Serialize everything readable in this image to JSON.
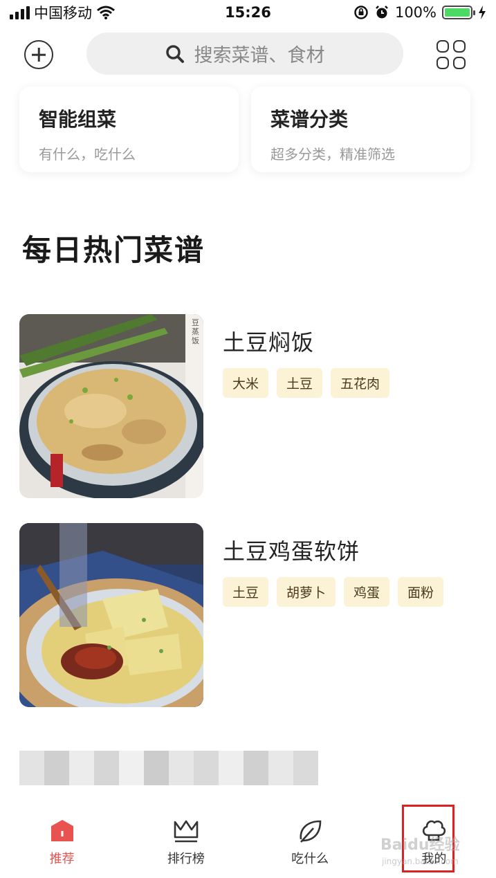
{
  "status_bar": {
    "carrier": "中国移动",
    "time": "15:26",
    "battery_percent": "100%"
  },
  "header": {
    "search_placeholder": "搜索菜谱、食材"
  },
  "feature_cards": [
    {
      "title": "智能组菜",
      "subtitle": "有什么，吃什么"
    },
    {
      "title": "菜谱分类",
      "subtitle": "超多分类，精准筛选"
    }
  ],
  "section": {
    "title": "每日热门菜谱"
  },
  "recipes": [
    {
      "title": "土豆焖饭",
      "tags": [
        "大米",
        "土豆",
        "五花肉"
      ],
      "image_text": "豆蒸饭"
    },
    {
      "title": "土豆鸡蛋软饼",
      "tags": [
        "土豆",
        "胡萝卜",
        "鸡蛋",
        "面粉"
      ]
    }
  ],
  "tabbar": {
    "items": [
      {
        "label": "推荐",
        "icon": "home-icon",
        "active": true
      },
      {
        "label": "排行榜",
        "icon": "crown-icon",
        "active": false
      },
      {
        "label": "吃什么",
        "icon": "leaf-icon",
        "active": false
      },
      {
        "label": "我的",
        "icon": "chef-hat-icon",
        "active": false
      }
    ]
  },
  "watermark": {
    "text": "Baidu经验",
    "sub": "jingyan.baidu.com"
  },
  "colors": {
    "accent": "#e8534f",
    "tag_bg": "#fcf2d6",
    "search_bg": "#efefef",
    "highlight": "#e02020"
  }
}
